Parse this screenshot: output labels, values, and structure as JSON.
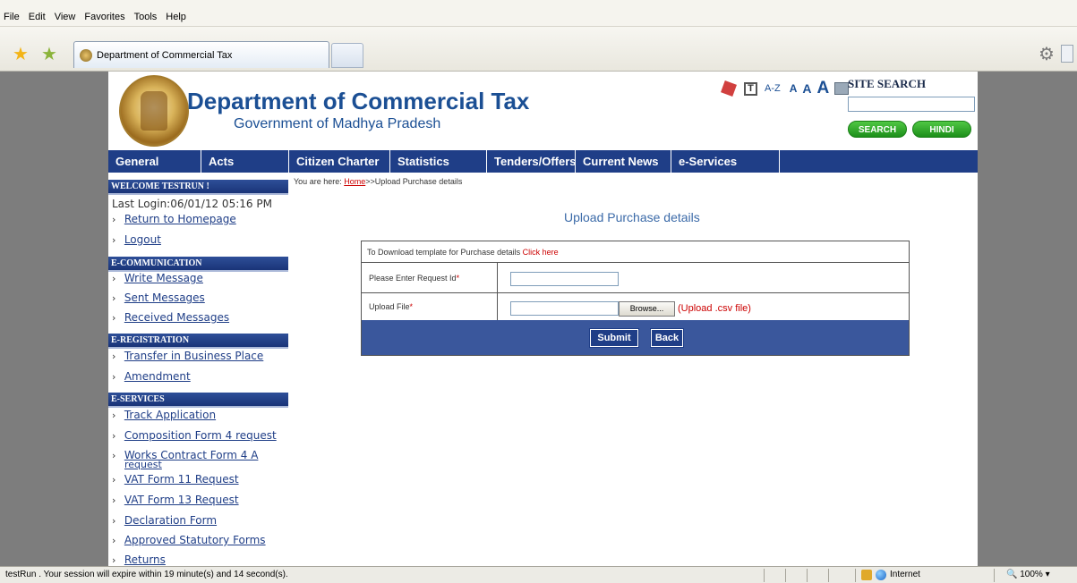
{
  "browser": {
    "menu": [
      "File",
      "Edit",
      "View",
      "Favorites",
      "Tools",
      "Help"
    ],
    "tab_title": "Department of Commercial Tax",
    "status_text": "testRun . Your session will expire within 19 minute(s) and 14 second(s).",
    "zone": "Internet",
    "zoom": "100%"
  },
  "header": {
    "title": "Department of Commercial Tax",
    "subtitle": "Government of Madhya Pradesh",
    "text_tools": {
      "t": "T",
      "az": "A-Z",
      "a_small": "A",
      "a_medium": "A",
      "a_large": "A"
    },
    "site_search_label": "SITE SEARCH",
    "search_button": "SEARCH",
    "hindi_button": "HINDI"
  },
  "nav": [
    "General",
    "Acts",
    "Citizen Charter",
    "Statistics",
    "Tenders/Offers",
    "Current News",
    "e-Services"
  ],
  "sidebar": {
    "welcome": "WELCOME TESTRUN !",
    "last_login": "Last Login:06/01/12 05:16 PM",
    "account_links": [
      "Return to Homepage",
      "Logout"
    ],
    "sections": [
      {
        "title": "E-COMMUNICATION",
        "items": [
          "Write Message",
          "Sent Messages",
          "Received Messages"
        ]
      },
      {
        "title": "E-REGISTRATION",
        "items": [
          "Transfer in Business Place",
          "Amendment"
        ]
      },
      {
        "title": "E-SERVICES",
        "items": [
          "Track Application",
          "Composition Form 4 request",
          "Works Contract Form 4 A",
          "request",
          "VAT Form 11 Request",
          "VAT Form 13 Request",
          "Declaration Form",
          "Approved Statutory Forms",
          "Returns"
        ]
      }
    ]
  },
  "breadcrumb": {
    "prefix": "You are here:",
    "home": "Home",
    "current": ">>Upload Purchase details"
  },
  "main": {
    "heading": "Upload Purchase details",
    "download_text": "To Download template for Purchase details",
    "download_link": "Click here",
    "request_label": "Please Enter Request Id",
    "upload_label": "Upload File",
    "required_mark": "*",
    "browse_label": "Browse...",
    "upload_hint": "(Upload .csv file)",
    "submit_label": "Submit",
    "back_label": "Back"
  },
  "colors": {
    "nav_blue": "#1f3e87",
    "action_bar": "#3a579c",
    "title_blue": "#1b4f94",
    "green": "#1c8f1a",
    "required_red": "#cc0000"
  }
}
